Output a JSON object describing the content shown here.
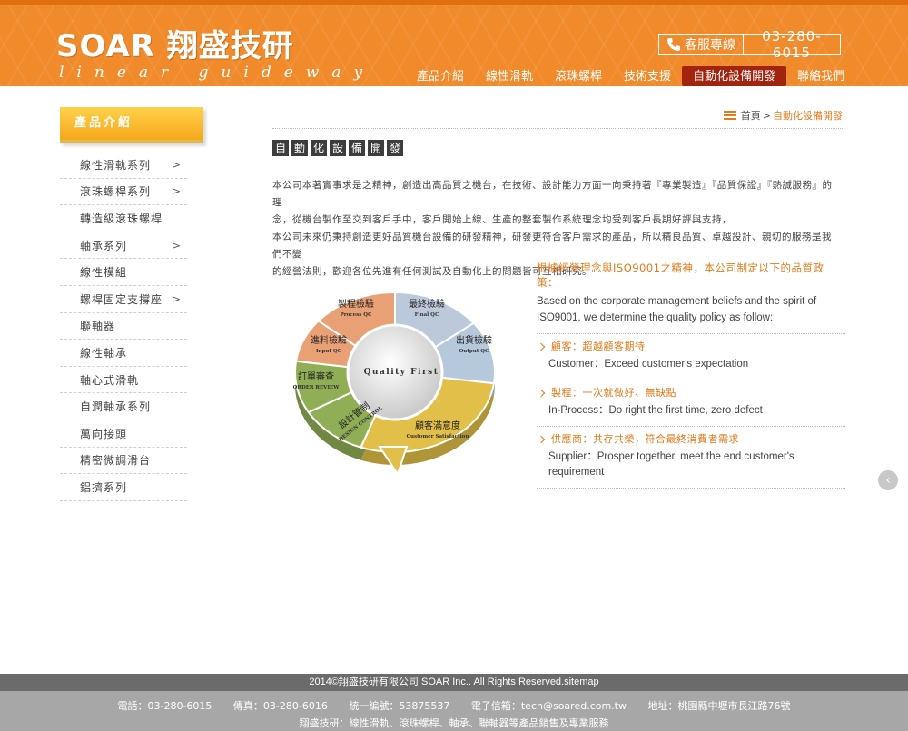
{
  "header": {
    "logo_main": "SOAR 翔盛技研",
    "logo_sub": "linear guideway",
    "hotline_label": "客服專線",
    "hotline_number": "03-280-6015",
    "nav": [
      "產品介紹",
      "線性滑軌",
      "滾珠螺桿",
      "技術支援",
      "自動化設備開發",
      "聯絡我們"
    ],
    "nav_active": "自動化設備開發",
    "accent_color": "#f08a2a"
  },
  "sidebar": {
    "title": "產品介紹",
    "items": [
      {
        "label": "線性滑軌系列",
        "arrow": ">"
      },
      {
        "label": "滾珠螺桿系列",
        "arrow": ">"
      },
      {
        "label": "轉造級滾珠螺桿",
        "arrow": ""
      },
      {
        "label": "軸承系列",
        "arrow": ">"
      },
      {
        "label": "線性模組",
        "arrow": ""
      },
      {
        "label": "螺桿固定支撐座",
        "arrow": ">"
      },
      {
        "label": "聯軸器",
        "arrow": ""
      },
      {
        "label": "線性軸承",
        "arrow": ""
      },
      {
        "label": "軸心式滑軌",
        "arrow": ""
      },
      {
        "label": "自潤軸承系列",
        "arrow": ""
      },
      {
        "label": "萬向接頭",
        "arrow": ""
      },
      {
        "label": "精密微調滑台",
        "arrow": ""
      },
      {
        "label": "鋁擠系列",
        "arrow": ""
      }
    ]
  },
  "breadcrumb": {
    "home": "首頁",
    "sep": ">",
    "current": "自動化設備開發"
  },
  "page_title": [
    "自",
    "動",
    "化",
    "設",
    "備",
    "開",
    "發"
  ],
  "intro": [
    "本公司本著實事求是之精神，創造出高品質之機台，在技術、設計能力方面一向秉持著『專業製造』『品質保證』『熱誠服務』的理",
    "念，從機台製作至交到客戶手中，客戶開始上線、生產的整套製作系統理念均受到客戶長期好評與支持，",
    "本公司未來仍秉持創造更好品質機台設備的研發精神，研發更符合客戶需求的產品，所以精良品質、卓越設計、親切的服務是我們不變",
    "的經營法則，歡迎各位先進有任何測試及自動化上的問題皆可互相研究。"
  ],
  "diagram": {
    "center": "Quality First",
    "segments": [
      {
        "zh": "製程檢驗",
        "en": "Process QC",
        "color": "#e8a074"
      },
      {
        "zh": "最終檢驗",
        "en": "Final QC",
        "color": "#bcc9db"
      },
      {
        "zh": "出貨檢驗",
        "en": "Output QC",
        "color": "#b6c8dc"
      },
      {
        "zh": "顧客滿意度",
        "en": "Customer Satisfaction",
        "color": "#e2bf48"
      },
      {
        "zh": "設計管制",
        "en": "DESIGN CONTROL",
        "color": "#8fae55"
      },
      {
        "zh": "訂單審查",
        "en": "ORDER REVIEW",
        "color": "#8fae55"
      },
      {
        "zh": "進料檢驗",
        "en": "Input QC",
        "color": "#e8a074"
      }
    ]
  },
  "policy": {
    "heading": "根據經營理念與ISO9001之精神，本公司制定以下的品質政策：",
    "en_line1": "Based on the corporate management beliefs and the spirit of",
    "en_line2": "ISO9001, we determine the quality policy as follow:",
    "items": [
      {
        "zh": "顧客：超越顧客期待",
        "en": "Customer：Exceed customer's expectation"
      },
      {
        "zh": "製程：一次就做好、無缺點",
        "en": "In-Process：Do right the first time, zero defect"
      },
      {
        "zh": "供應商：共存共榮，符合最終消費者需求",
        "en": "Supplier：Prosper together, meet the end customer's requirement"
      }
    ]
  },
  "footer": {
    "copyright": "2014©翔盛技研有限公司 SOAR Inc.. All Rights Reserved.sitemap",
    "phone": "電話：03-280-6015",
    "fax": "傳真：03-280-6016",
    "tax_id": "統一編號：53875537",
    "email": "電子信箱：tech@soared.com.tw",
    "address": "地址：桃園縣中壢市長江路76號",
    "line2": "翔盛技研：線性滑軌、滾珠螺桿、軸承、聯軸器等產品銷售及專業服務"
  }
}
